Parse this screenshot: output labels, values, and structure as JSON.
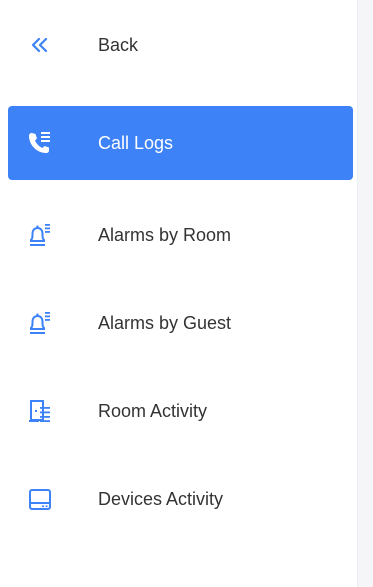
{
  "nav": {
    "back": {
      "label": "Back",
      "icon": "double-chevron-left-icon"
    },
    "items": [
      {
        "label": "Call Logs",
        "icon": "call-log-icon",
        "active": true
      },
      {
        "label": "Alarms by Room",
        "icon": "bell-list-icon",
        "active": false
      },
      {
        "label": "Alarms by Guest",
        "icon": "bell-list-icon",
        "active": false
      },
      {
        "label": "Room Activity",
        "icon": "door-list-icon",
        "active": false
      },
      {
        "label": "Devices Activity",
        "icon": "device-icon",
        "active": false
      }
    ]
  },
  "colors": {
    "accent": "#3d82f6",
    "text": "#333333",
    "active_text": "#ffffff"
  }
}
